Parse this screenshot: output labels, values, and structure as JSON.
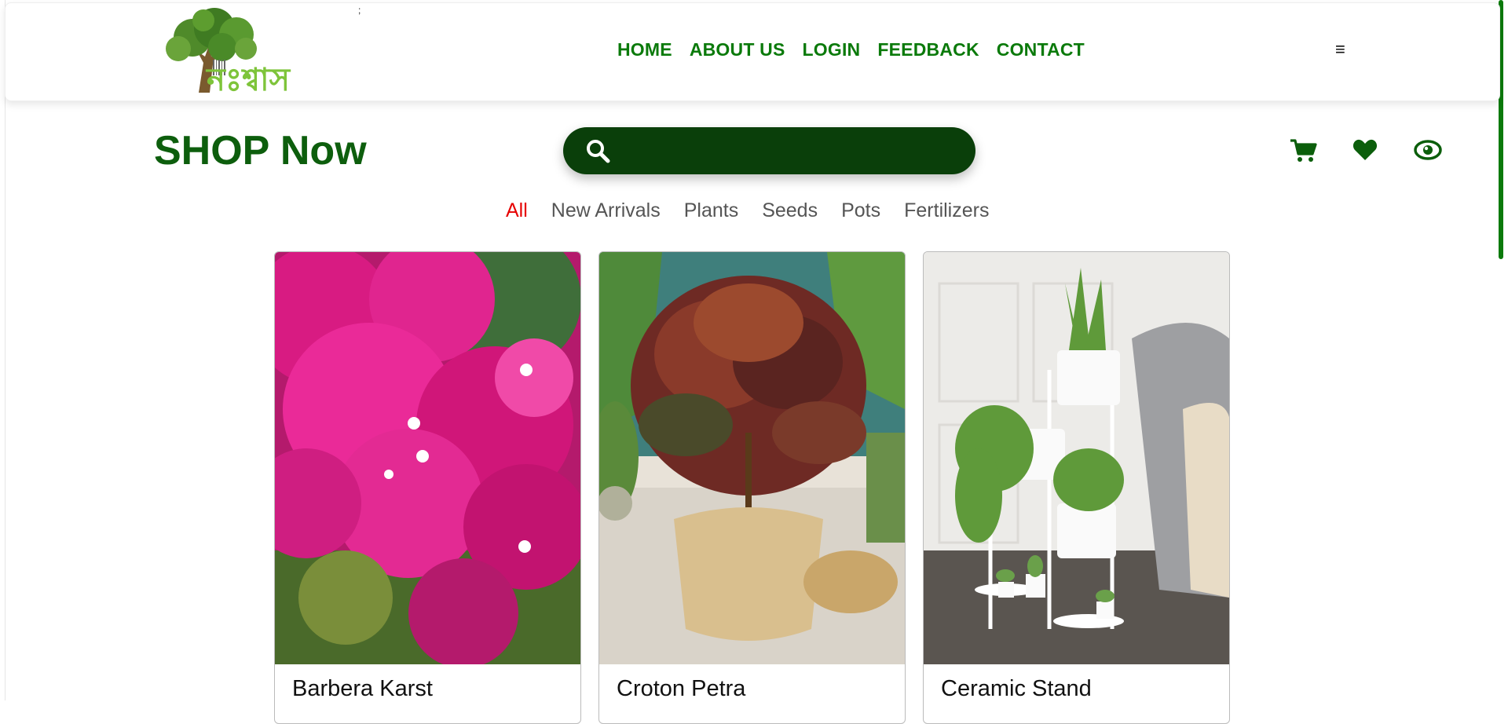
{
  "header": {
    "logo_text": "নঃশ্বাস",
    "nav": [
      "HOME",
      "ABOUT US",
      "LOGIN",
      "FEEDBACK",
      "CONTACT"
    ],
    "menu_icon": "≡"
  },
  "shop": {
    "title": "SHOP Now",
    "search_placeholder": ""
  },
  "icons": {
    "cart": "cart-icon",
    "wishlist": "heart-icon",
    "view": "eye-icon"
  },
  "categories": [
    {
      "label": "All",
      "active": true
    },
    {
      "label": "New Arrivals",
      "active": false
    },
    {
      "label": "Plants",
      "active": false
    },
    {
      "label": "Seeds",
      "active": false
    },
    {
      "label": "Pots",
      "active": false
    },
    {
      "label": "Fertilizers",
      "active": false
    }
  ],
  "products": [
    {
      "name": "Barbera Karst"
    },
    {
      "name": "Croton Petra"
    },
    {
      "name": "Ceramic Stand"
    }
  ],
  "colors": {
    "brand_green": "#0b7a0b",
    "title_green": "#0d5e0d",
    "search_bg": "#0a3f0a",
    "active_category": "#e60000"
  }
}
